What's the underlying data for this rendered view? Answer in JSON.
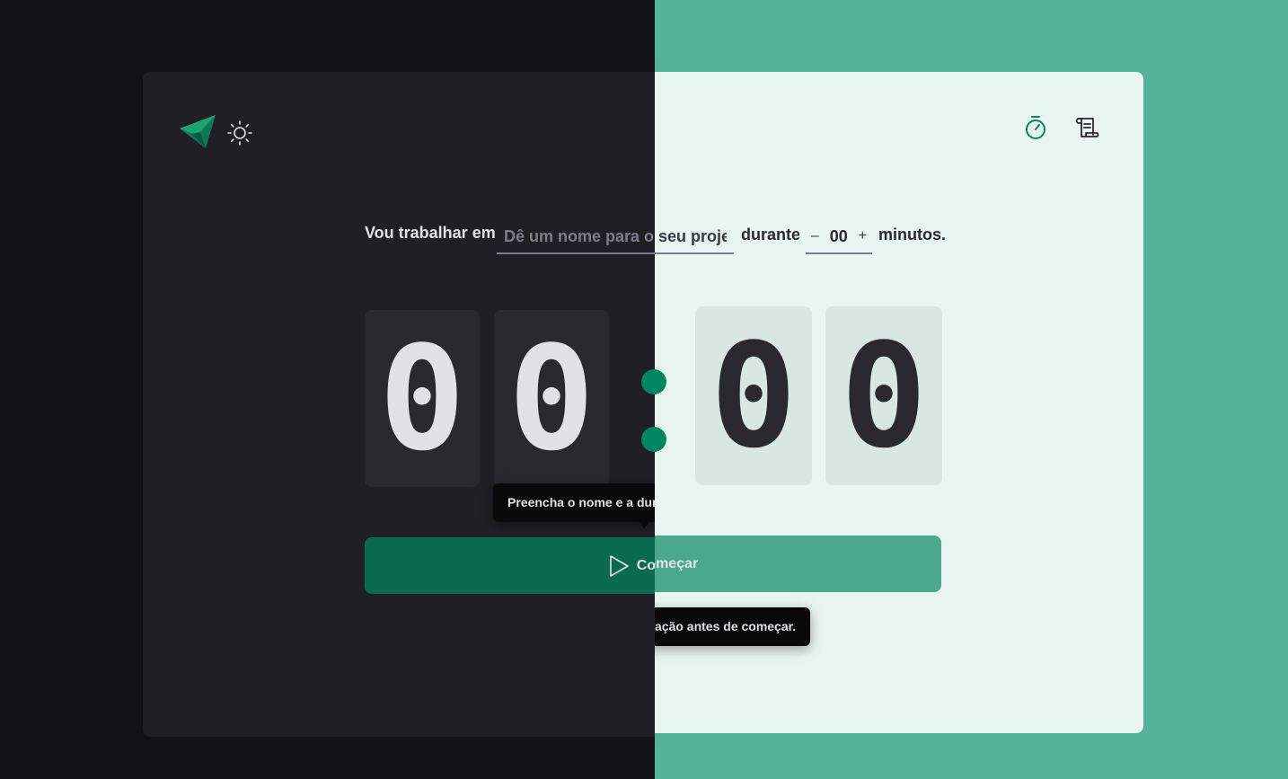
{
  "colors": {
    "dark_background": "#121214",
    "dark_card": "#202024",
    "light_background": "#54b397",
    "light_card": "#e8f5f1",
    "accent_green": "#00875f"
  },
  "header": {
    "logo_icon": "paper-plane-logo-icon",
    "theme_icon": "sun-icon",
    "nav": [
      {
        "icon": "timer-icon"
      },
      {
        "icon": "scroll-history-icon"
      }
    ]
  },
  "form": {
    "work_label": "Vou trabalhar em",
    "task_placeholder": "Dê um nome para o seu projeto",
    "during_label": "durante",
    "minus": "–",
    "minutes_value": "00",
    "plus": "+",
    "minutes_label": "minutos."
  },
  "countdown": {
    "minutes_tens": "0",
    "minutes_ones": "0",
    "seconds_tens": "0",
    "seconds_ones": "0"
  },
  "start_button": {
    "label": "Começar",
    "icon": "play-icon"
  },
  "tooltip": {
    "text": "Preencha o nome e a duração antes de começar."
  }
}
